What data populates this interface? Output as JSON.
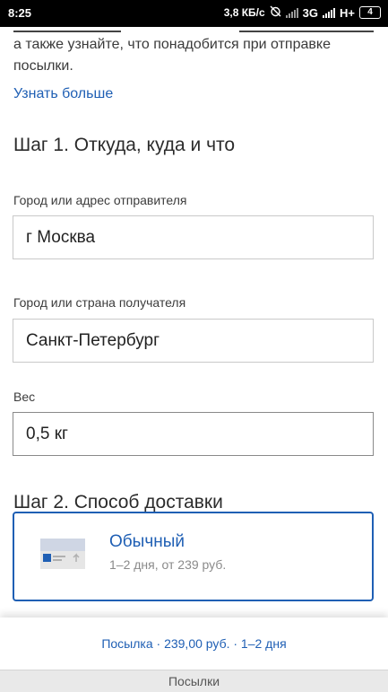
{
  "status_bar": {
    "time": "8:25",
    "network_speed": "3,8 КБ/с",
    "network_type": "3G",
    "network_type2": "H+",
    "battery": "4"
  },
  "intro": {
    "text_line1": "",
    "text_line2": "а также узнайте, что понадобится при отправке",
    "text_line3": "посылки.",
    "more_link": "Узнать больше"
  },
  "step1": {
    "title": "Шаг 1. Откуда, куда и что",
    "sender_label": "Город или адрес отправителя",
    "sender_value": "г Москва",
    "recipient_label": "Город или страна получателя",
    "recipient_value": "Санкт-Петербург",
    "weight_label": "Вес",
    "weight_value": "0,5 кг"
  },
  "step2": {
    "title": "Шаг 2. Способ доставки",
    "option": {
      "title": "Обычный",
      "subtitle": "1–2 дня, от 239 руб.",
      "icon": "parcel-box-icon"
    }
  },
  "summary": {
    "text": "Посылка · 239,00 руб. · 1–2 дня"
  },
  "bottom_tab": {
    "label": "Посылки"
  },
  "colors": {
    "accent": "#1f5fb4",
    "status_bar": "#000000",
    "muted": "#8a8a8a"
  }
}
